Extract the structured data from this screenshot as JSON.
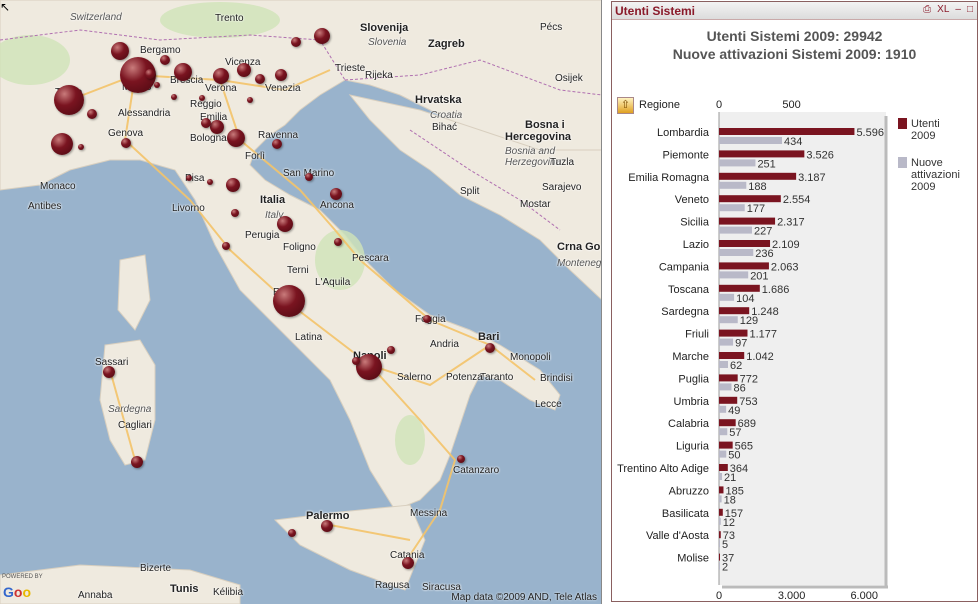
{
  "map": {
    "attribution": "Map data ©2009 AND, Tele Atlas",
    "powered_by": "POWERED BY",
    "logo": "Goo",
    "labels": [
      {
        "t": "Switzerland",
        "cls": "it"
      },
      {
        "t": "Trento",
        "cls": ""
      },
      {
        "t": "Slovenija",
        "cls": "big"
      },
      {
        "t": "Slovenia",
        "cls": "it"
      },
      {
        "t": "Zagreb",
        "cls": "big"
      },
      {
        "t": "Pécs",
        "cls": ""
      },
      {
        "t": "Osijek",
        "cls": ""
      },
      {
        "t": "Bergamo",
        "cls": ""
      },
      {
        "t": "Vicenza",
        "cls": ""
      },
      {
        "t": "Trieste",
        "cls": ""
      },
      {
        "t": "Rijeka",
        "cls": ""
      },
      {
        "t": "Hrvatska",
        "cls": "big"
      },
      {
        "t": "Croatia",
        "cls": "it"
      },
      {
        "t": "Torino",
        "cls": ""
      },
      {
        "t": "Milano",
        "cls": ""
      },
      {
        "t": "Brescia",
        "cls": ""
      },
      {
        "t": "Verona",
        "cls": ""
      },
      {
        "t": "Venezia",
        "cls": ""
      },
      {
        "t": "Alessandria",
        "cls": ""
      },
      {
        "t": "Reggio",
        "cls": ""
      },
      {
        "t": "Emilia",
        "cls": ""
      },
      {
        "t": "Bihać",
        "cls": ""
      },
      {
        "t": "Bosna i",
        "cls": "big"
      },
      {
        "t": "Hercegovina",
        "cls": "big"
      },
      {
        "t": "Bosnia and",
        "cls": "it"
      },
      {
        "t": "Herzegovina",
        "cls": "it"
      },
      {
        "t": "Genova",
        "cls": ""
      },
      {
        "t": "Bologna",
        "cls": ""
      },
      {
        "t": "Ravenna",
        "cls": ""
      },
      {
        "t": "Tuzla",
        "cls": ""
      },
      {
        "t": "Monaco",
        "cls": ""
      },
      {
        "t": "Forlì",
        "cls": ""
      },
      {
        "t": "Antibes",
        "cls": ""
      },
      {
        "t": "San Marino",
        "cls": ""
      },
      {
        "t": "Sarajevo",
        "cls": ""
      },
      {
        "t": "Pisa",
        "cls": ""
      },
      {
        "t": "Split",
        "cls": ""
      },
      {
        "t": "Livorno",
        "cls": ""
      },
      {
        "t": "Italia",
        "cls": "big"
      },
      {
        "t": "Italy",
        "cls": "it"
      },
      {
        "t": "Ancona",
        "cls": ""
      },
      {
        "t": "Mostar",
        "cls": ""
      },
      {
        "t": "Perugia",
        "cls": ""
      },
      {
        "t": "Crna Go",
        "cls": "big"
      },
      {
        "t": "Foligno",
        "cls": ""
      },
      {
        "t": "Montenegro",
        "cls": "it"
      },
      {
        "t": "Pescara",
        "cls": ""
      },
      {
        "t": "Terni",
        "cls": ""
      },
      {
        "t": "L'Aquila",
        "cls": ""
      },
      {
        "t": "Roma",
        "cls": ""
      },
      {
        "t": "Foggia",
        "cls": ""
      },
      {
        "t": "Latina",
        "cls": ""
      },
      {
        "t": "Bari",
        "cls": "big"
      },
      {
        "t": "Andria",
        "cls": ""
      },
      {
        "t": "Sassari",
        "cls": ""
      },
      {
        "t": "Monopoli",
        "cls": ""
      },
      {
        "t": "Napoli",
        "cls": "big"
      },
      {
        "t": "Taranto",
        "cls": ""
      },
      {
        "t": "Salerno",
        "cls": ""
      },
      {
        "t": "Potenza",
        "cls": ""
      },
      {
        "t": "Brindisi",
        "cls": ""
      },
      {
        "t": "Sardegna",
        "cls": "it"
      },
      {
        "t": "Lecce",
        "cls": ""
      },
      {
        "t": "Cagliari",
        "cls": ""
      },
      {
        "t": "Catanzaro",
        "cls": ""
      },
      {
        "t": "Palermo",
        "cls": "big"
      },
      {
        "t": "Messina",
        "cls": ""
      },
      {
        "t": "Bizerte",
        "cls": ""
      },
      {
        "t": "Catania",
        "cls": ""
      },
      {
        "t": "Tunis",
        "cls": "big"
      },
      {
        "t": "Kélibia",
        "cls": ""
      },
      {
        "t": "Ragusa",
        "cls": ""
      },
      {
        "t": "Siracusa",
        "cls": ""
      },
      {
        "t": "Annaba",
        "cls": ""
      }
    ],
    "bubbles": [
      {
        "city": "Milano",
        "value": 18
      },
      {
        "city": "Roma",
        "value": 16
      },
      {
        "city": "Torino",
        "value": 15
      },
      {
        "city": "Napoli",
        "value": 13
      },
      {
        "city": "Cuneo",
        "value": 11
      }
    ]
  },
  "panel": {
    "title": "Utenti Sistemi",
    "controls": [
      "⎙",
      "XL",
      "–",
      "□"
    ],
    "chart_title_line1": "Utenti Sistemi  2009: 29942",
    "chart_title_line2": "Nuove attivazioni Sistemi  2009: 1910",
    "dimension_label": "Regione",
    "sort_icon": "sort-up-icon",
    "colors": {
      "utenti": "#7a1420",
      "nuove": "#b9b9c8",
      "plot_bg": "#efefef"
    }
  },
  "chart_data": {
    "type": "bar",
    "orientation": "horizontal",
    "categories": [
      "Lombardia",
      "Piemonte",
      "Emilia Romagna",
      "Veneto",
      "Sicilia",
      "Lazio",
      "Campania",
      "Toscana",
      "Sardegna",
      "Friuli",
      "Marche",
      "Puglia",
      "Umbria",
      "Calabria",
      "Liguria",
      "Trentino Alto Adige",
      "Abruzzo",
      "Basilicata",
      "Valle d'Aosta",
      "Molise"
    ],
    "series": [
      {
        "name": "Utenti 2009",
        "values": [
          5596,
          3526,
          3187,
          2554,
          2317,
          2109,
          2063,
          1686,
          1248,
          1177,
          1042,
          772,
          753,
          689,
          565,
          364,
          185,
          157,
          73,
          37
        ],
        "labels": [
          "5.596",
          "3.526",
          "3.187",
          "2.554",
          "2.317",
          "2.109",
          "2.063",
          "1.686",
          "1.248",
          "1.177",
          "1.042",
          "772",
          "753",
          "689",
          "565",
          "364",
          "185",
          "157",
          "73",
          "37"
        ]
      },
      {
        "name": "Nuove attivazioni 2009",
        "values": [
          434,
          251,
          188,
          177,
          227,
          236,
          201,
          104,
          129,
          97,
          62,
          86,
          49,
          57,
          50,
          21,
          18,
          12,
          5,
          2
        ],
        "labels": [
          "434",
          "251",
          "188",
          "177",
          "227",
          "236",
          "201",
          "104",
          "129",
          "97",
          "62",
          "86",
          "49",
          "57",
          "50",
          "21",
          "18",
          "12",
          "5",
          "2"
        ]
      }
    ],
    "axes": {
      "top": {
        "ticks": [
          0,
          500
        ],
        "tick_labels": [
          "0",
          "500"
        ],
        "range": [
          0,
          1150
        ]
      },
      "bottom": {
        "ticks": [
          0,
          3000,
          6000
        ],
        "tick_labels": [
          "0",
          "3.000",
          "6.000"
        ],
        "range": [
          0,
          6900
        ]
      }
    },
    "legend": {
      "placement": "right",
      "entries": [
        "Utenti 2009",
        "Nuove attivazioni 2009"
      ],
      "lines": [
        [
          "Utenti",
          "2009"
        ],
        [
          "Nuove",
          "attivazioni",
          "2009"
        ]
      ]
    }
  }
}
